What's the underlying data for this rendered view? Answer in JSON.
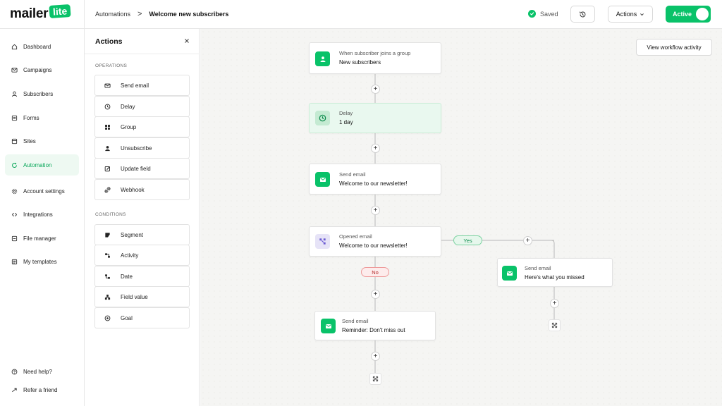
{
  "brand": {
    "word": "mailer",
    "badge": "lite",
    "accent": "#09c269"
  },
  "breadcrumb": {
    "parent": "Automations",
    "separator": ">",
    "current": "Welcome new subscribers"
  },
  "header": {
    "saved_label": "Saved",
    "actions_label": "Actions",
    "active_label": "Active",
    "active_on": true
  },
  "sidebar": {
    "items": [
      {
        "label": "Dashboard",
        "icon": "home-icon"
      },
      {
        "label": "Campaigns",
        "icon": "mail-icon"
      },
      {
        "label": "Subscribers",
        "icon": "user-icon"
      },
      {
        "label": "Forms",
        "icon": "form-icon"
      },
      {
        "label": "Sites",
        "icon": "site-icon"
      },
      {
        "label": "Automation",
        "icon": "automation-icon",
        "active": true
      },
      {
        "label": "Account settings",
        "icon": "gear-icon"
      },
      {
        "label": "Integrations",
        "icon": "integration-icon"
      },
      {
        "label": "File manager",
        "icon": "file-icon"
      },
      {
        "label": "My templates",
        "icon": "template-icon"
      }
    ],
    "footer": [
      {
        "label": "Need help?",
        "icon": "help-icon"
      },
      {
        "label": "Refer a friend",
        "icon": "refer-icon"
      }
    ]
  },
  "panel": {
    "title": "Actions",
    "operations_label": "OPERATIONS",
    "operations": [
      {
        "label": "Send email",
        "icon": "envelope-icon"
      },
      {
        "label": "Delay",
        "icon": "clock-icon"
      },
      {
        "label": "Group",
        "icon": "group-icon"
      },
      {
        "label": "Unsubscribe",
        "icon": "person-icon"
      },
      {
        "label": "Update field",
        "icon": "edit-icon"
      },
      {
        "label": "Webhook",
        "icon": "link-icon"
      }
    ],
    "conditions_label": "CONDITIONS",
    "conditions": [
      {
        "label": "Segment",
        "icon": "segment-icon"
      },
      {
        "label": "Activity",
        "icon": "activity-icon"
      },
      {
        "label": "Date",
        "icon": "date-icon"
      },
      {
        "label": "Field value",
        "icon": "field-icon"
      },
      {
        "label": "Goal",
        "icon": "goal-icon"
      }
    ]
  },
  "canvas": {
    "view_activity_label": "View workflow activity",
    "nodes": {
      "trigger": {
        "label": "When subscriber joins a group",
        "value": "New subscribers"
      },
      "delay": {
        "label": "Delay",
        "value": "1 day"
      },
      "email1": {
        "label": "Send email",
        "value": "Welcome to our newsletter!"
      },
      "condition": {
        "label": "Opened email",
        "value": "Welcome to our newsletter!"
      },
      "email_no": {
        "label": "Send email",
        "value": "Reminder: Don't miss out"
      },
      "email_yes": {
        "label": "Send email",
        "value": "Here's what you missed"
      }
    },
    "branch_yes": "Yes",
    "branch_no": "No",
    "plus_symbol": "+"
  }
}
